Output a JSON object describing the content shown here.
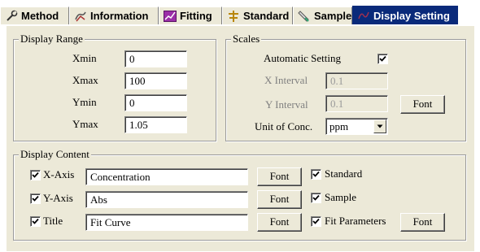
{
  "tabs": [
    {
      "label": "Method",
      "icon": "wrench-icon"
    },
    {
      "label": "Information",
      "icon": "info-icon"
    },
    {
      "label": "Fitting",
      "icon": "fitting-chart-icon"
    },
    {
      "label": "Standard",
      "icon": "standard-icon"
    },
    {
      "label": "Sample",
      "icon": "sample-icon"
    },
    {
      "label": "Display Setting",
      "icon": "display-setting-icon",
      "active": true
    }
  ],
  "display_range": {
    "title": "Display Range",
    "xmin": {
      "label": "Xmin",
      "value": "0"
    },
    "xmax": {
      "label": "Xmax",
      "value": "100"
    },
    "ymin": {
      "label": "Ymin",
      "value": "0"
    },
    "ymax": {
      "label": "Ymax",
      "value": "1.05"
    }
  },
  "scales": {
    "title": "Scales",
    "automatic_label": "Automatic Setting",
    "automatic_checked": true,
    "x_interval": {
      "label": "X Interval",
      "value": "0.1"
    },
    "y_interval": {
      "label": "Y Interval",
      "value": "0.1"
    },
    "font_button": "Font",
    "unit": {
      "label": "Unit of Conc.",
      "value": "ppm"
    }
  },
  "display_content": {
    "title": "Display Content",
    "x_axis": {
      "label": "X-Axis",
      "checked": true,
      "value": "Concentration",
      "font_button": "Font"
    },
    "y_axis": {
      "label": "Y-Axis",
      "checked": true,
      "value": "Abs",
      "font_button": "Font"
    },
    "title_row": {
      "label": "Title",
      "checked": true,
      "value": "Fit Curve",
      "font_button": "Font"
    },
    "standard": {
      "label": "Standard",
      "checked": true
    },
    "sample": {
      "label": "Sample",
      "checked": true
    },
    "fit_parameters": {
      "label": "Fit Parameters",
      "checked": true,
      "font_button": "Font"
    }
  },
  "colors": {
    "panel_bg": "#ece9d8",
    "active_tab_bg": "#0a2a7a",
    "active_tab_text": "#ffffff"
  }
}
